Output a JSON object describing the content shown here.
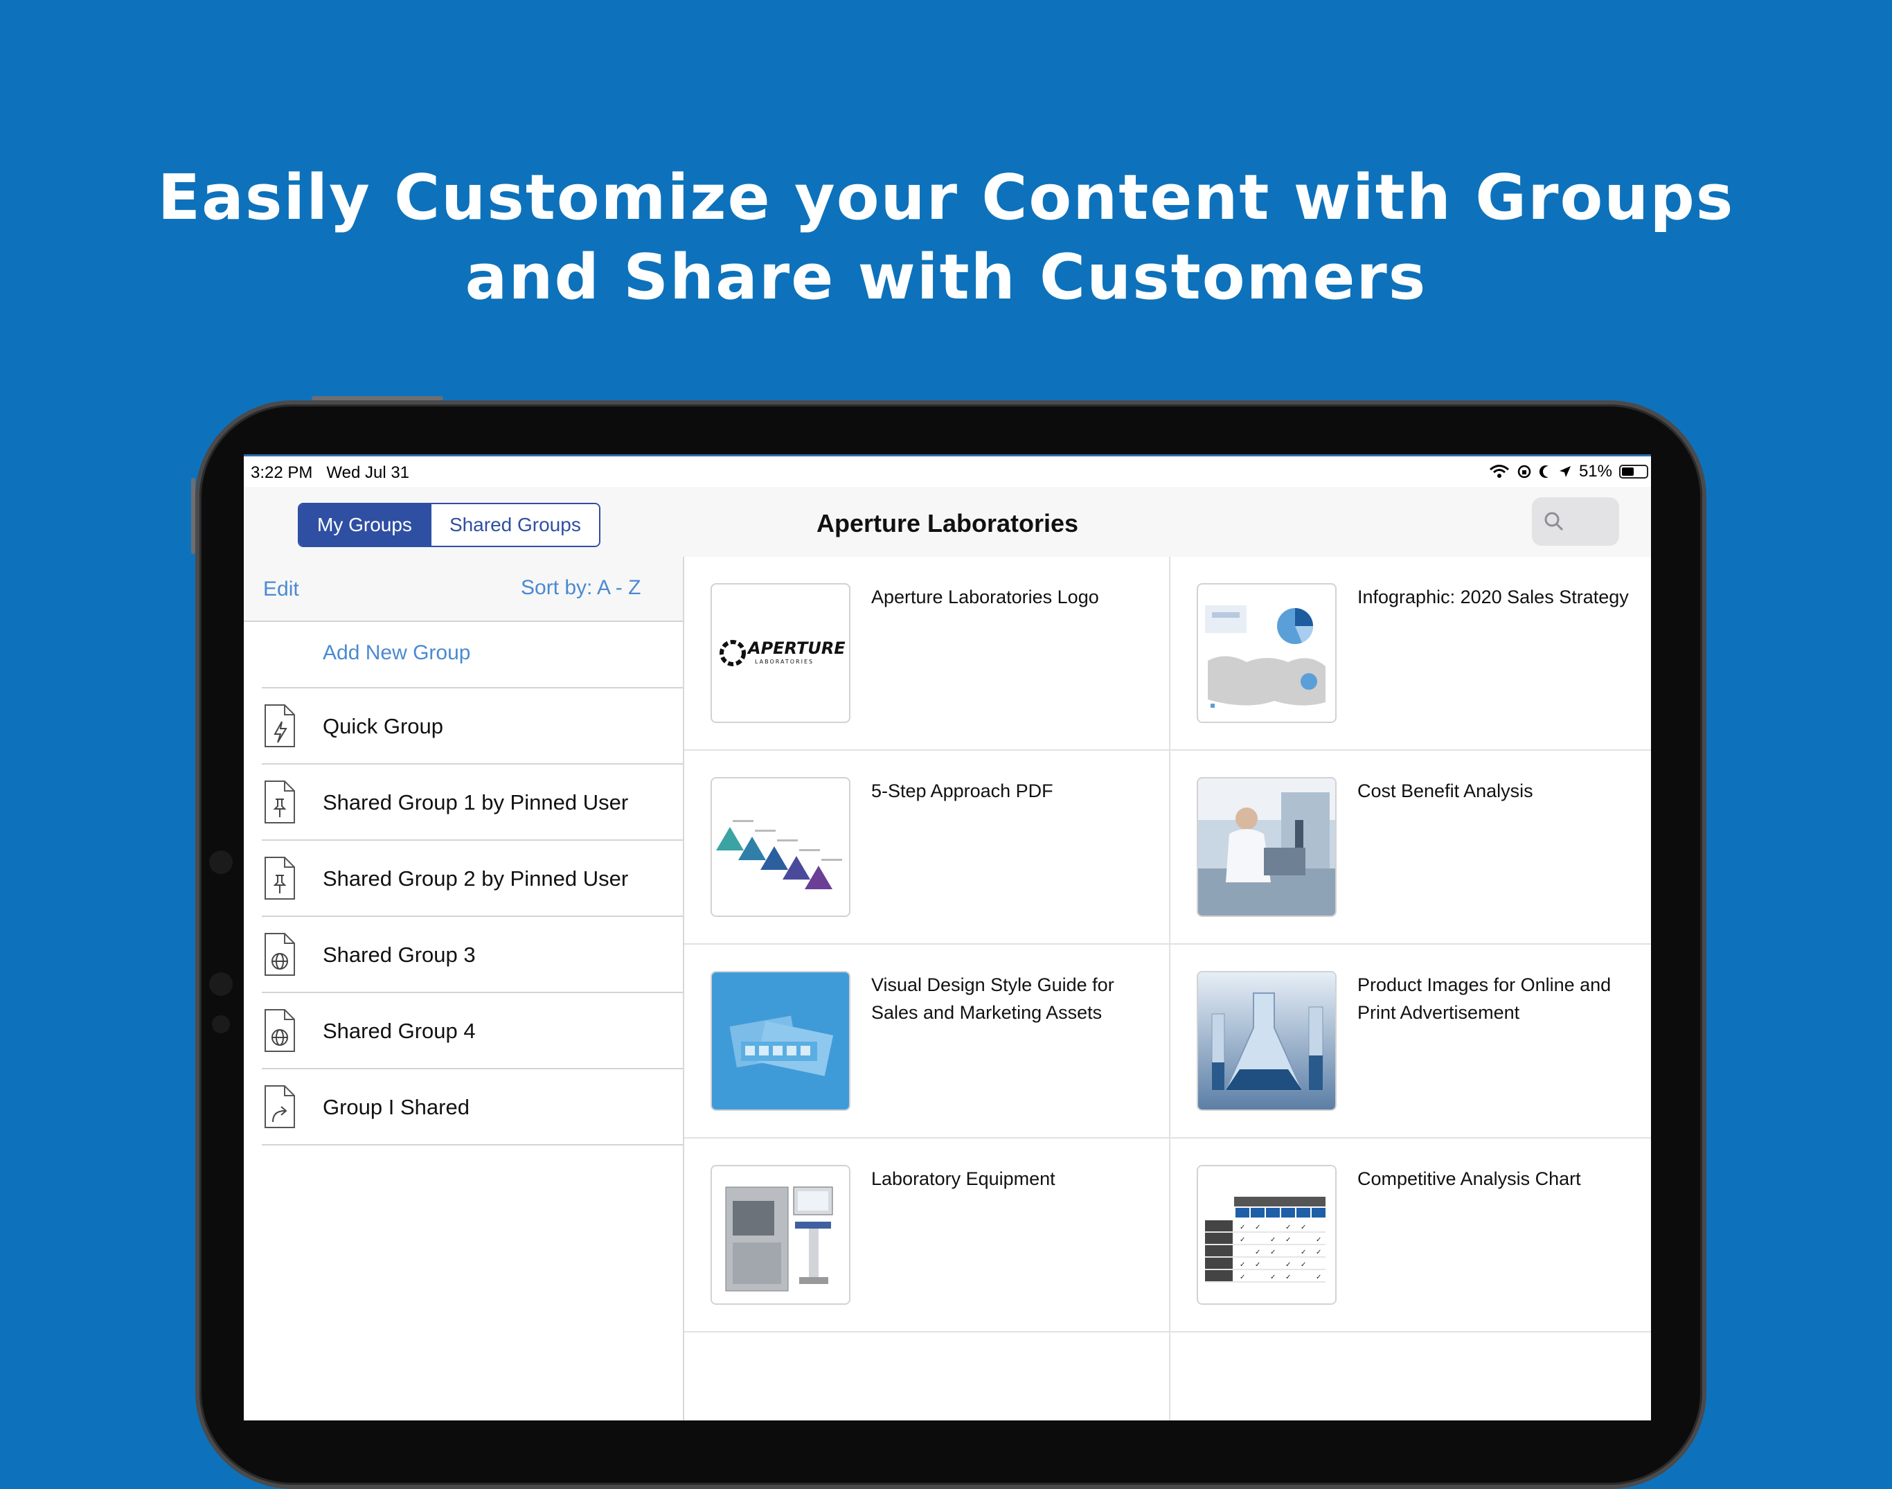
{
  "headline": {
    "line1": "Easily Customize your Content with Groups",
    "line2": "and Share with Customers"
  },
  "status_bar": {
    "time": "3:22 PM",
    "date": "Wed Jul 31",
    "battery": "51%",
    "battery_level": 0.51
  },
  "nav": {
    "segment_my": "My Groups",
    "segment_shared": "Shared Groups",
    "title": "Aperture Laboratories",
    "search_icon": "search-icon"
  },
  "sidebar": {
    "edit": "Edit",
    "sort": "Sort by: A - Z",
    "add_group": "Add New Group",
    "groups": [
      {
        "label": "Quick Group",
        "icon": "lightning-doc-icon"
      },
      {
        "label": "Shared Group 1 by Pinned User",
        "icon": "pin-doc-icon"
      },
      {
        "label": "Shared Group 2 by Pinned User",
        "icon": "pin-doc-icon"
      },
      {
        "label": "Shared Group 3",
        "icon": "globe-doc-icon"
      },
      {
        "label": "Shared Group 4",
        "icon": "globe-doc-icon"
      },
      {
        "label": "Group I Shared",
        "icon": "share-doc-icon"
      }
    ]
  },
  "content": {
    "items": [
      {
        "title": "Aperture Laboratories Logo",
        "thumb": "aperture-logo"
      },
      {
        "title": "Infographic: 2020 Sales Strategy",
        "thumb": "infographic"
      },
      {
        "title": "5-Step Approach PDF",
        "thumb": "five-step"
      },
      {
        "title": "Cost Benefit Analysis",
        "thumb": "lab-scientist-photo"
      },
      {
        "title": "Visual Design Style Guide for Sales and Marketing Assets",
        "thumb": "style-guide"
      },
      {
        "title": "Product Images for Online and Print Advertisement",
        "thumb": "lab-glassware-photo"
      },
      {
        "title": "Laboratory Equipment",
        "thumb": "lab-equipment-photo"
      },
      {
        "title": "Competitive Analysis Chart",
        "thumb": "analysis-chart"
      }
    ],
    "logo_text_1": "APERTURE",
    "logo_text_2": "LABORATORIES"
  },
  "colors": {
    "background": "#0d72bb",
    "accent": "#2f4fa2",
    "link": "#4a8ad0"
  }
}
